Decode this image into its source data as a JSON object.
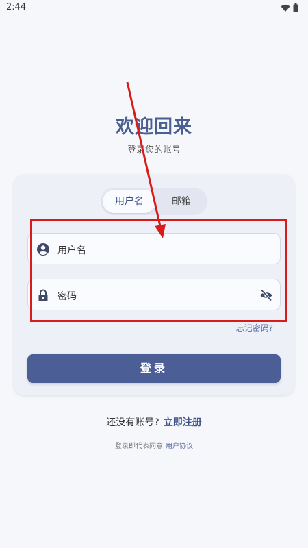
{
  "status_bar": {
    "time": "2:44",
    "icons": [
      "wifi-icon",
      "battery-icon"
    ]
  },
  "header": {
    "title": "欢迎回来",
    "subtitle": "登录您的账号"
  },
  "tabs": [
    {
      "label": "用户名",
      "active": true
    },
    {
      "label": "邮箱",
      "active": false
    }
  ],
  "form": {
    "username": {
      "label": "用户名",
      "icon": "user-icon"
    },
    "password": {
      "label": "密码",
      "icon": "lock-icon",
      "toggle_icon": "eye-off-icon"
    },
    "forgot_label": "忘记密码?",
    "login_label": "登录"
  },
  "footer": {
    "register_prompt": "还没有账号?",
    "register_link": "立即注册",
    "agree_text": "登录即代表同意",
    "agree_link": "用户协议"
  },
  "annotation": {
    "color": "#d81c1c"
  },
  "colors": {
    "primary": "#4b5f96",
    "title": "#4a5f91",
    "background": "#f6f7fb"
  }
}
